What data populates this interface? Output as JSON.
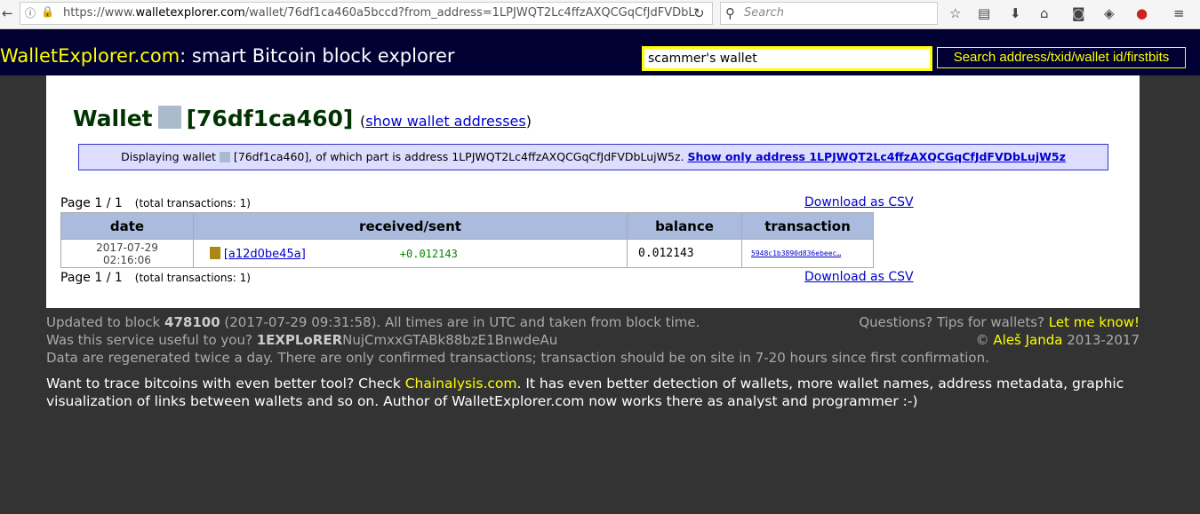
{
  "browser": {
    "url_prefix": "https://www.",
    "url_domain": "walletexplorer.com",
    "url_rest": "/wallet/76df1ca460a5bccd?from_address=1LPJWQT2Lc4ffzAXQCGqCfJdFVDbL",
    "search_placeholder": "Search"
  },
  "header": {
    "logo": "WalletExplorer.com",
    "tagline": ": smart Bitcoin block explorer",
    "query": "scammer's wallet",
    "search_button": "Search address/txid/wallet id/firstbits"
  },
  "wallet": {
    "title": "Wallet",
    "id": "[76df1ca460]",
    "show_addresses": "show wallet addresses",
    "color": "#aabbcc"
  },
  "info": {
    "text1": "Displaying wallet",
    "text2": "[76df1ca460], of which part is address 1LPJWQT2Lc4ffzAXQCGqCfJdFVDbLujW5z.",
    "link": "Show only address 1LPJWQT2Lc4ffzAXQCGqCfJdFVDbLujW5z"
  },
  "pager": {
    "page": "Page 1 / 1",
    "total": "(total transactions: 1)",
    "csv": "Download as CSV"
  },
  "table": {
    "headers": [
      "date",
      "received/sent",
      "balance",
      "transaction"
    ],
    "rows": [
      {
        "date": "2017-07-29 02:16:06",
        "wallet": "[a12d0be45a]",
        "amount": "+0.012143",
        "balance": "0.012143",
        "tx": "5948c1b3890d836ebeec…"
      }
    ]
  },
  "footer": {
    "updated_pre": "Updated to block ",
    "block": "478100",
    "updated_post": " (2017-07-29 09:31:58). All times are in UTC and taken from block time.",
    "useful": "Was this service useful to you? ",
    "addr_bold": "1EXPLoRER",
    "addr_rest": "NujCmxxGTABk88bzE1BnwdeAu",
    "regen": "Data are regenerated twice a day. There are only confirmed transactions; transaction should be on site in 7-20 hours since first confirmation.",
    "questions": "Questions? Tips for wallets? ",
    "let_me_know": "Let me know!",
    "copy": "© ",
    "author": "Aleš Janda",
    "years": " 2013-2017",
    "trace_pre": "Want to trace bitcoins with even better tool? Check ",
    "chainalysis": "Chainalysis.com",
    "trace_post": ". It has even better detection of wallets, more wallet names, address metadata, graphic visualization of links between wallets and so on. Author of WalletExplorer.com now works there as analyst and programmer :-)"
  }
}
